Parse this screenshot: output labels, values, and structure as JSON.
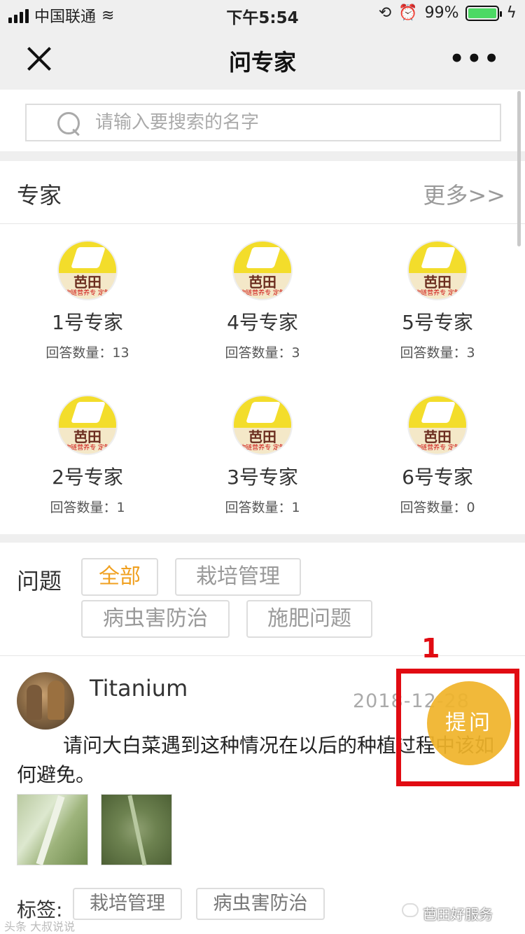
{
  "status_bar": {
    "carrier": "中国联通",
    "time": "下午5:54",
    "battery": "99%",
    "battery_level": 0.99
  },
  "navbar": {
    "title": "问专家",
    "more_label": "•••"
  },
  "search": {
    "placeholder": "请输入要搜索的名字"
  },
  "experts_section": {
    "title": "专家",
    "more": "更多>>",
    "logo_text": "芭田",
    "logo_sub": "物链营养专 定制",
    "items": [
      {
        "name": "1号专家",
        "count": "回答数量：13"
      },
      {
        "name": "4号专家",
        "count": "回答数量：3"
      },
      {
        "name": "5号专家",
        "count": "回答数量：3"
      },
      {
        "name": "2号专家",
        "count": "回答数量：1"
      },
      {
        "name": "3号专家",
        "count": "回答数量：1"
      },
      {
        "name": "6号专家",
        "count": "回答数量：0"
      }
    ]
  },
  "question_filters": {
    "label": "问题",
    "tags": [
      "全部",
      "栽培管理",
      "病虫害防治",
      "施肥问题"
    ],
    "active": "全部"
  },
  "post": {
    "user": "Titanium",
    "date": "2018-12-28",
    "text": "请问大白菜遇到这种情况在以后的种植过程中该如何避免。",
    "tags_label": "标签:",
    "tags": [
      "栽培管理",
      "病虫害防治"
    ]
  },
  "ask_button": {
    "label": "提问"
  },
  "annotation": {
    "number": "1",
    "color": "#e10b12"
  },
  "watermarks": {
    "left": "头条 大叔说说",
    "right": "芭田好服务"
  },
  "colors": {
    "accent": "#f0a020",
    "ask_button": "#f0b42a",
    "background": "#efefef"
  }
}
